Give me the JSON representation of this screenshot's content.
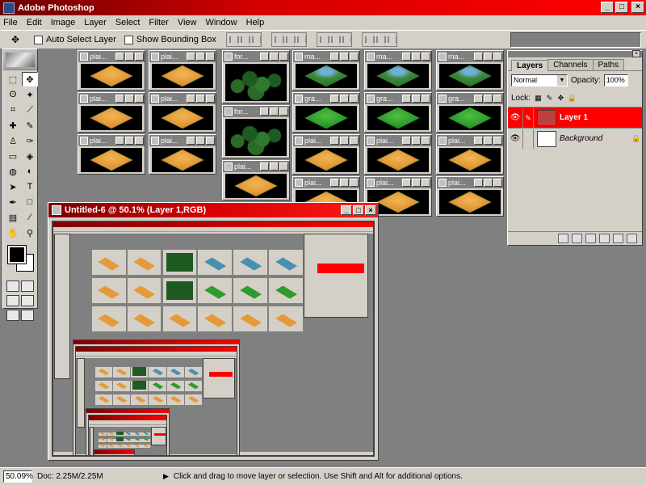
{
  "app": {
    "title": "Adobe Photoshop"
  },
  "window_buttons": [
    "_",
    "□",
    "×"
  ],
  "menu": [
    "File",
    "Edit",
    "Image",
    "Layer",
    "Select",
    "Filter",
    "View",
    "Window",
    "Help"
  ],
  "options": {
    "auto_select": "Auto Select Layer",
    "bounding_box": "Show Bounding Box"
  },
  "doc_titles": {
    "plain": "plai...",
    "forest": "for...",
    "marsh": "ma...",
    "grass": "gra..."
  },
  "layers_palette": {
    "tabs": [
      "Layers",
      "Channels",
      "Paths"
    ],
    "blend_mode": "Normal",
    "opacity_label": "Opacity:",
    "opacity_value": "100%",
    "lock_label": "Lock:",
    "layers": [
      {
        "name": "Layer 1",
        "selected": true
      },
      {
        "name": "Background",
        "selected": false
      }
    ]
  },
  "main_document": {
    "title": "Untitled-6 @ 50.1% (Layer 1,RGB)"
  },
  "status": {
    "zoom": "50.09%",
    "doc": "Doc: 2.25M/2.25M",
    "message": "Click and drag to move layer or selection.  Use Shift and Alt for additional options."
  },
  "colors": {
    "accent": "#ff0000",
    "workspace": "#808080",
    "chrome": "#d4d0c8"
  },
  "icons": {
    "move_tool": "move-tool-icon",
    "marquee": "marquee-icon",
    "lasso": "lasso-icon",
    "crop": "crop-icon",
    "eye": "eye-icon"
  }
}
